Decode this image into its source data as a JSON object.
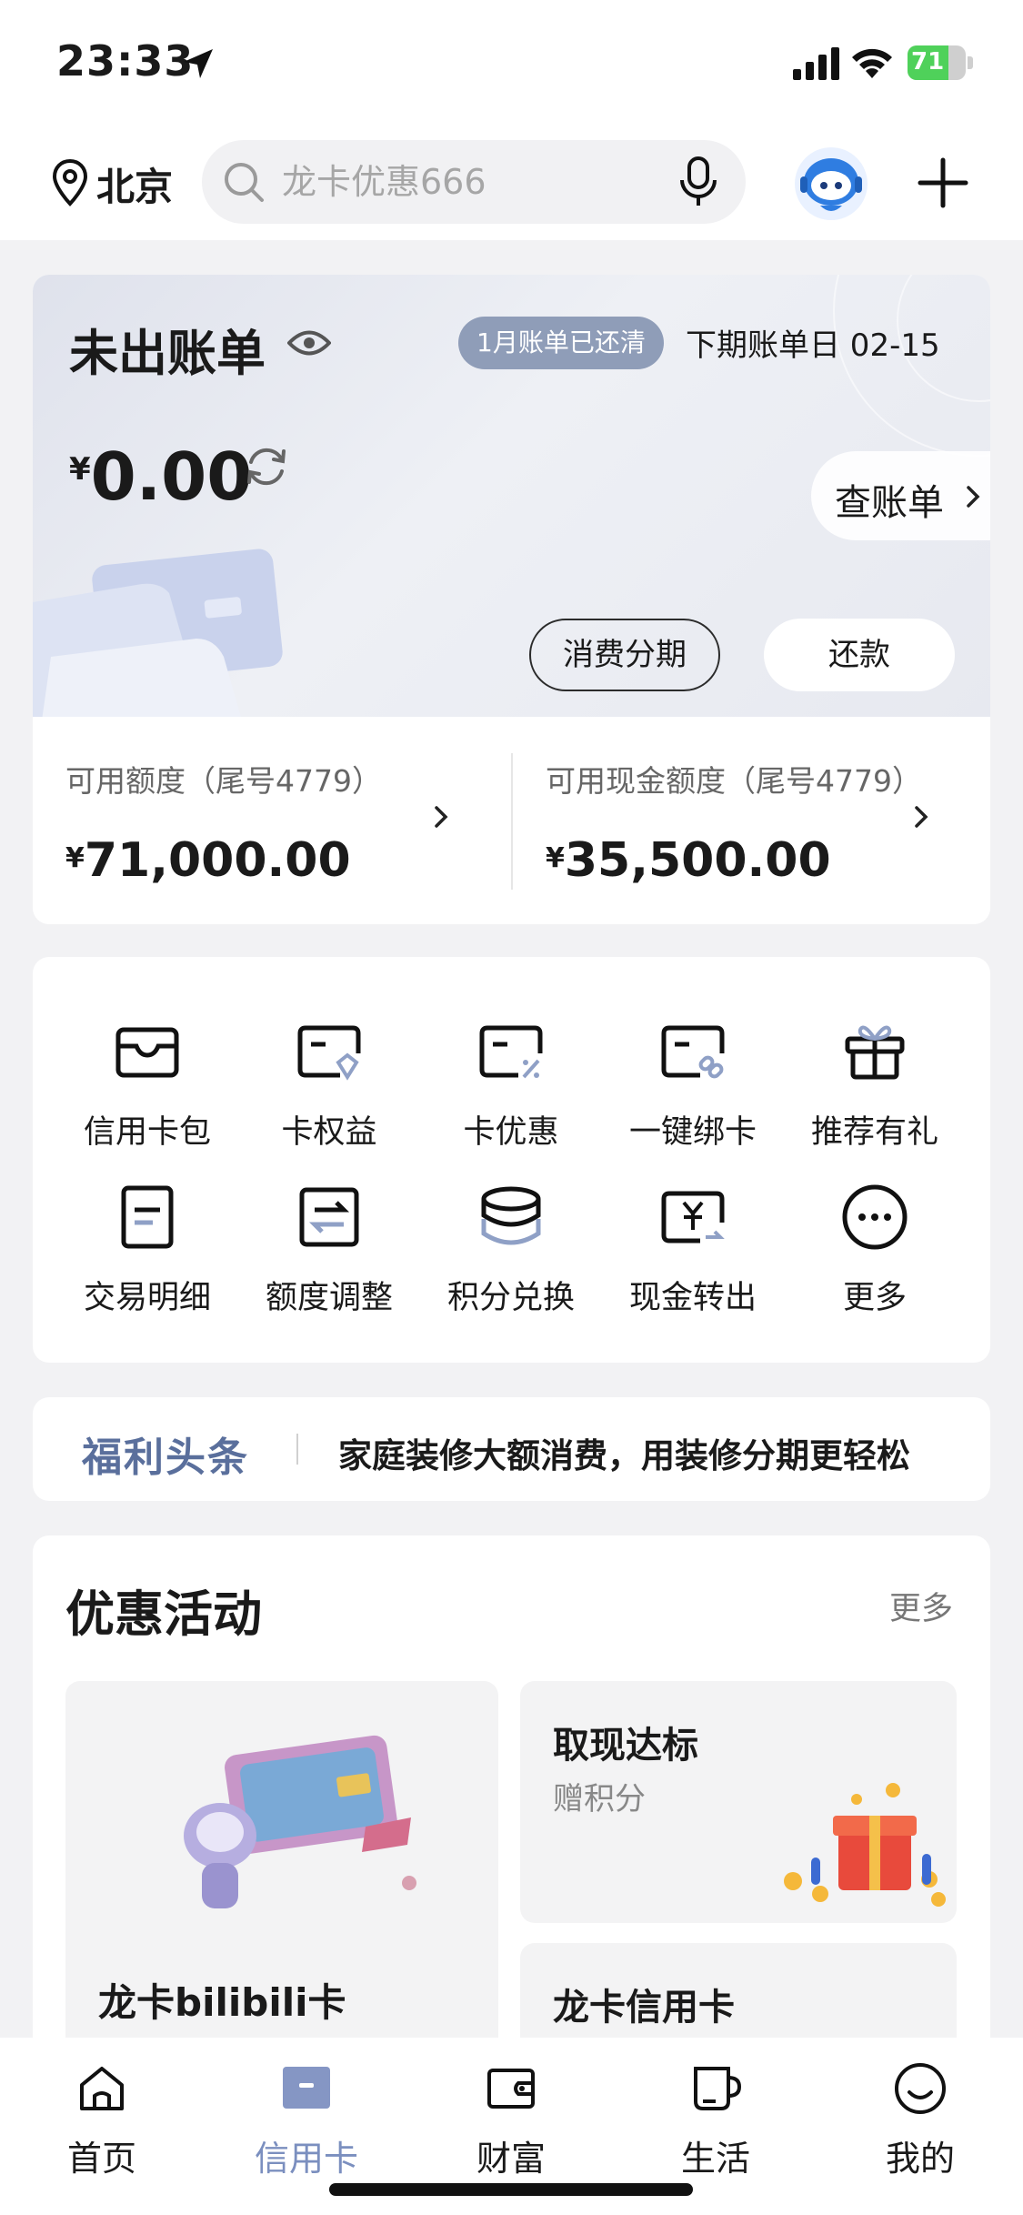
{
  "status": {
    "time": "23:33",
    "battery": "71",
    "battery_level": 0.71
  },
  "topnav": {
    "city": "北京",
    "search_placeholder": "龙卡优惠666"
  },
  "bill": {
    "title": "未出账单",
    "paid_badge": "1月账单已还清",
    "next_bill": "下期账单日 02-15",
    "currency": "¥",
    "amount": "0.00",
    "check_bill": "查账单",
    "installment": "消费分期",
    "repay": "还款",
    "limits": [
      {
        "label": "可用额度（尾号4779）",
        "currency": "¥",
        "value": "71,000.00"
      },
      {
        "label": "可用现金额度（尾号4779）",
        "currency": "¥",
        "value": "35,500.00"
      }
    ]
  },
  "grid": {
    "items": [
      {
        "label": "信用卡包",
        "icon": "card-wallet-icon"
      },
      {
        "label": "卡权益",
        "icon": "card-benefit-icon"
      },
      {
        "label": "卡优惠",
        "icon": "card-discount-icon"
      },
      {
        "label": "一键绑卡",
        "icon": "card-bind-icon"
      },
      {
        "label": "推荐有礼",
        "icon": "gift-icon"
      },
      {
        "label": "交易明细",
        "icon": "transaction-detail-icon"
      },
      {
        "label": "额度调整",
        "icon": "limit-adjust-icon"
      },
      {
        "label": "积分兑换",
        "icon": "points-coins-icon"
      },
      {
        "label": "现金转出",
        "icon": "cash-transfer-icon"
      },
      {
        "label": "更多",
        "icon": "more-icon"
      }
    ]
  },
  "welfare": {
    "tag": "福利头条",
    "message": "家庭装修大额消费，用装修分期更轻松"
  },
  "promo": {
    "title": "优惠活动",
    "more": "更多",
    "big_card": {
      "name": "龙卡bilibili卡"
    },
    "card_right_1": {
      "title": "取现达标",
      "subtitle": "赠积分"
    },
    "card_right_2": {
      "title": "龙卡信用卡"
    }
  },
  "tabbar": {
    "tabs": [
      {
        "label": "首页",
        "icon": "home-icon"
      },
      {
        "label": "信用卡",
        "icon": "credit-card-icon"
      },
      {
        "label": "财富",
        "icon": "wallet-icon"
      },
      {
        "label": "生活",
        "icon": "cup-icon"
      },
      {
        "label": "我的",
        "icon": "smile-icon"
      }
    ],
    "active_index": 1
  },
  "colors": {
    "accent": "#7b8fbf",
    "badge": "#8f9db8",
    "battery": "#4fd15a",
    "welfare_tag": "#5a6f9c"
  }
}
